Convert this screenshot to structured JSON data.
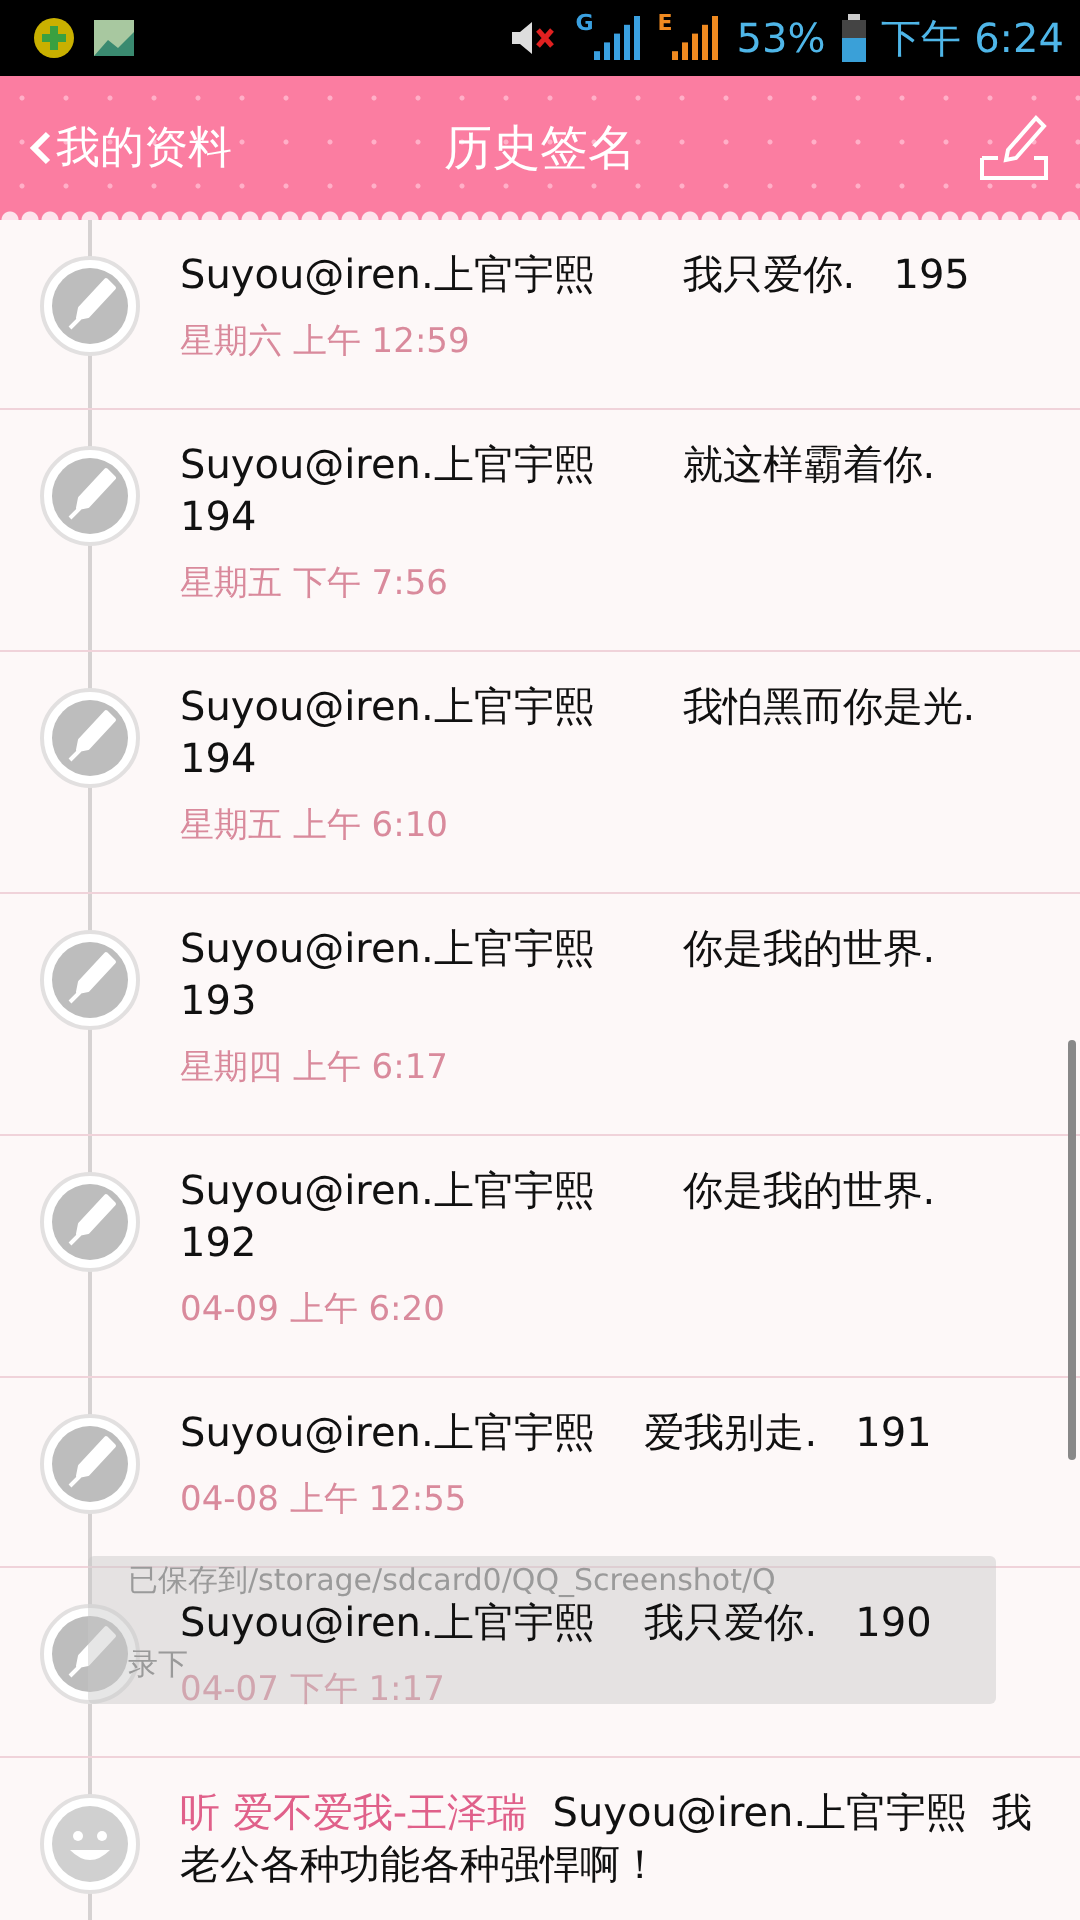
{
  "status_bar": {
    "battery": "53%",
    "time": "下午 6:24",
    "network_1": "G",
    "network_2": "E"
  },
  "header": {
    "back": "我的资料",
    "title": "历史签名"
  },
  "items": [
    {
      "kind": "signature",
      "text": "Suyou@iren.上官宇熙       我只爱你.   195",
      "date": "星期六 上午 12:59"
    },
    {
      "kind": "signature",
      "text": "Suyou@iren.上官宇熙       就这样霸着你. 194",
      "date": "星期五 下午 7:56"
    },
    {
      "kind": "signature",
      "text": "Suyou@iren.上官宇熙       我怕黑而你是光. 194",
      "date": "星期五 上午 6:10"
    },
    {
      "kind": "signature",
      "text": "Suyou@iren.上官宇熙       你是我的世界. 193",
      "date": "星期四 上午 6:17"
    },
    {
      "kind": "signature",
      "text": "Suyou@iren.上官宇熙       你是我的世界. 192",
      "date": "04-09 上午 6:20"
    },
    {
      "kind": "signature",
      "text": "Suyou@iren.上官宇熙    爱我别走.   191",
      "date": "04-08 上午 12:55"
    },
    {
      "kind": "signature",
      "text": "Suyou@iren.上官宇熙    我只爱你.   190",
      "date": "04-07 下午 1:17"
    },
    {
      "kind": "music",
      "music": "听 爱不爱我-王泽瑞",
      "text": "Suyou@iren.上官宇熙  我老公各种功能各种强悍啊！"
    }
  ],
  "toast": {
    "text": "已保存到/storage/sdcard0/QQ_Screenshot/Q",
    "text_2": "录下"
  }
}
